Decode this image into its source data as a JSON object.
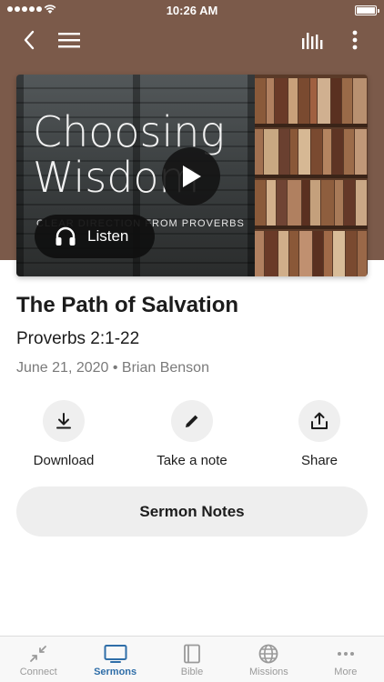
{
  "status_bar": {
    "time": "10:26 AM",
    "battery_level": 1.0
  },
  "artwork": {
    "title_line1": "Choosing",
    "title_line2": "Wisdom",
    "subtitle": "CLEAR DIRECTION FROM PROVERBS",
    "listen_label": "Listen"
  },
  "sermon": {
    "title": "The Path of Salvation",
    "scripture": "Proverbs 2:1-22",
    "meta": "June 21, 2020 • Brian Benson"
  },
  "actions": {
    "download": "Download",
    "note": "Take a note",
    "share": "Share"
  },
  "notes_button": "Sermon Notes",
  "tabs": [
    {
      "label": "Connect",
      "icon": "connect-icon",
      "active": false
    },
    {
      "label": "Sermons",
      "icon": "tv-icon",
      "active": true
    },
    {
      "label": "Bible",
      "icon": "book-icon",
      "active": false
    },
    {
      "label": "Missions",
      "icon": "globe-icon",
      "active": false
    },
    {
      "label": "More",
      "icon": "more-icon",
      "active": false
    }
  ],
  "colors": {
    "header_brown": "#7b5a4a",
    "active_tab": "#2f6ea8",
    "inactive_tab": "#9a9a9a"
  }
}
